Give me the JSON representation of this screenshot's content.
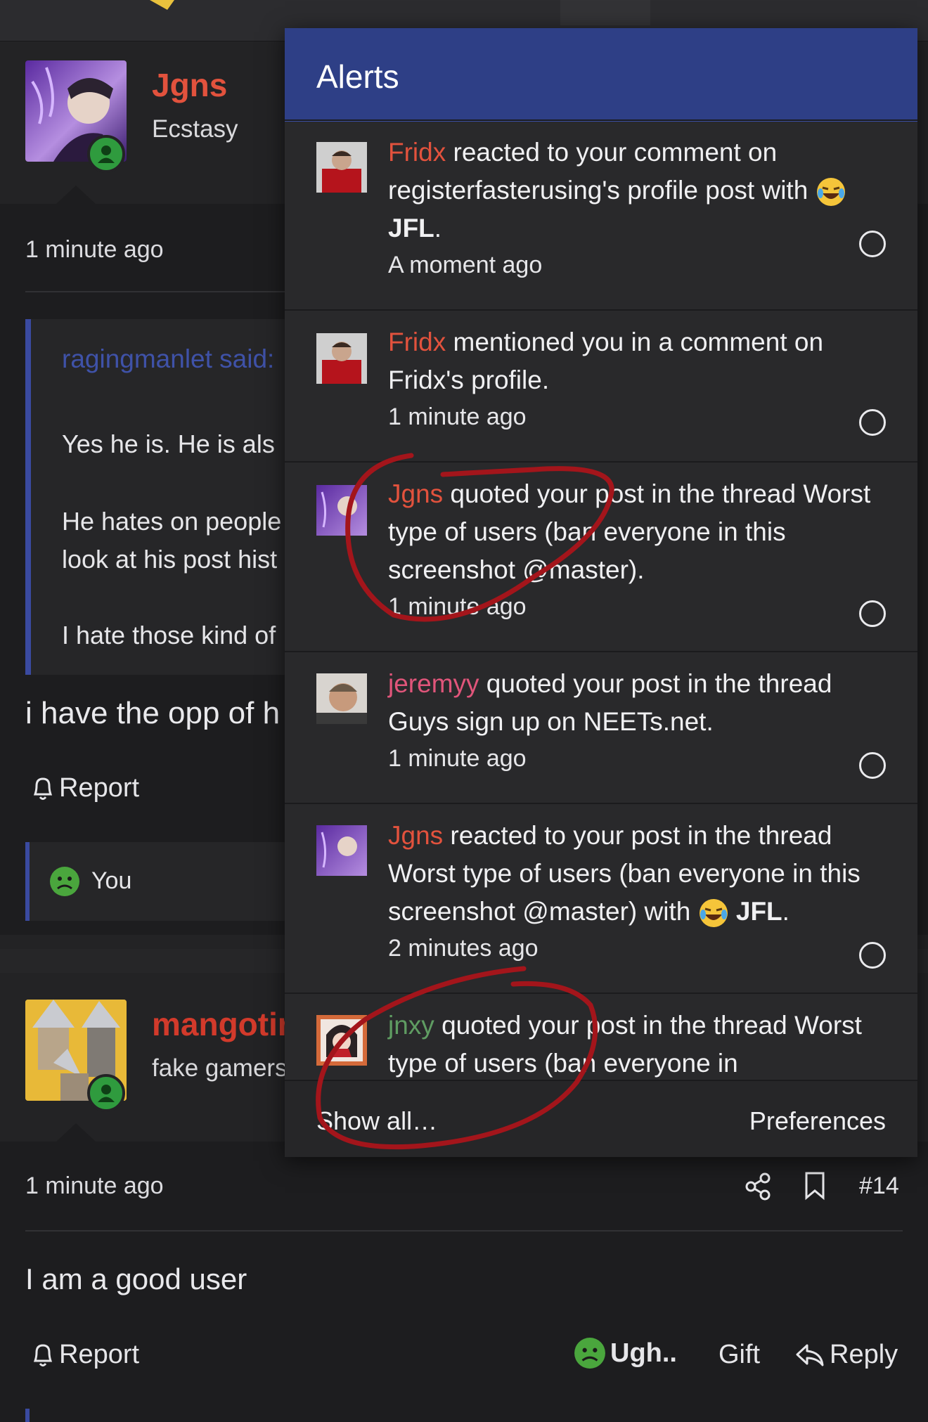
{
  "post1": {
    "username": "Jgns",
    "user_title": "Ecstasy",
    "time": "1 minute ago",
    "quote_author": "ragingmanlet said:",
    "quote_lines": [
      "Yes he is. He is als",
      "He hates on people",
      "look at his post hist",
      "I hate those kind of"
    ],
    "message": "i have the opp of h",
    "report_label": "Report",
    "reaction_user": "You"
  },
  "post2": {
    "username": "mangotir",
    "user_title": "fake gamers",
    "time": "1 minute ago",
    "post_number": "#14",
    "message": "I am a good user",
    "report_label": "Report",
    "reaction_label": "Ugh..",
    "gift_label": "Gift",
    "reply_label": "Reply"
  },
  "alerts": {
    "title": "Alerts",
    "items": [
      {
        "user": "Fridx",
        "text": " reacted to your comment on registerfasterusing's profile post with ",
        "reaction": "JFL",
        "tail": ".",
        "time": "A moment ago"
      },
      {
        "user": "Fridx",
        "text": " mentioned you in a comment on Fridx's profile.",
        "time": "1 minute ago"
      },
      {
        "user": "Jgns",
        "text": " quoted your post in the thread Worst type of users (ban everyone in this screenshot @master).",
        "time": "1 minute ago"
      },
      {
        "user": "jeremyy",
        "text": " quoted your post in the thread Guys sign up on NEETs.net.",
        "time": "1 minute ago"
      },
      {
        "user": "Jgns",
        "text": " reacted to your post in the thread Worst type of users (ban everyone in this screenshot @master) with ",
        "reaction": "JFL",
        "tail": ".",
        "time": "2 minutes ago"
      },
      {
        "user": "jnxy",
        "text": " quoted your post in the thread Worst type of users (ban everyone in"
      }
    ],
    "show_all": "Show all…",
    "preferences": "Preferences"
  },
  "colors": {
    "accent_blue": "#2e3f86",
    "username_red": "#e2523d",
    "annotation_red": "#a3151b"
  }
}
